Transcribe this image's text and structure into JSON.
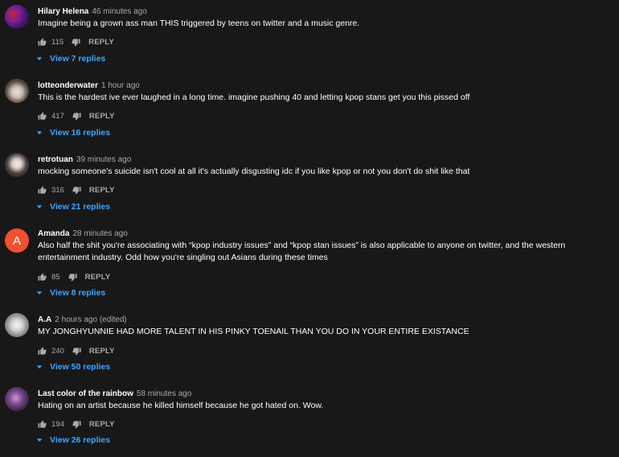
{
  "colors": {
    "background": "#181818",
    "link": "#3ea6ff",
    "muted": "#aaaaaa"
  },
  "comments": [
    {
      "author": "Hilary Helena",
      "time": "46 minutes ago",
      "text": "Imagine being a grown ass man THIS triggered by teens on twitter and a music genre.",
      "likes": "115",
      "reply": "REPLY",
      "view": "View 7 replies",
      "avatar": "avatar-photo"
    },
    {
      "author": "lotteonderwater",
      "time": "1 hour ago",
      "text": "This is the hardest ive ever laughed in a long time. imagine pushing 40 and letting kpop stans get you this pissed off",
      "likes": "417",
      "reply": "REPLY",
      "view": "View 16 replies",
      "avatar": "avatar-photo"
    },
    {
      "author": "retrotuan",
      "time": "39 minutes ago",
      "text": "mocking someone's suicide isn't cool at all it's actually disgusting idc if you like kpop or not you don't do shit like that",
      "likes": "316",
      "reply": "REPLY",
      "view": "View 21 replies",
      "avatar": "avatar-photo"
    },
    {
      "author": "Amanda",
      "time": "28 minutes ago",
      "text": "Also half the shit you're associating with “kpop industry issues” and “kpop stan issues” is also applicable to anyone on twitter, and the western entertainment industry. Odd how you're singling out Asians during these times",
      "likes": "85",
      "reply": "REPLY",
      "view": "View 8 replies",
      "avatar": "A",
      "avatar_color": "#ef5130"
    },
    {
      "author": "A.A",
      "time": "2 hours ago (edited)",
      "text": "MY JONGHYUNNIE HAD MORE TALENT IN HIS PINKY TOENAIL THAN YOU DO IN YOUR ENTIRE EXISTANCE",
      "likes": "240",
      "reply": "REPLY",
      "view": "View 50 replies",
      "avatar": "avatar-photo"
    },
    {
      "author": "Last color of the rainbow",
      "time": "58 minutes ago",
      "text": "Hating on an artist because he killed himself because he got hated on. Wow.",
      "likes": "194",
      "reply": "REPLY",
      "view": "View 26 replies",
      "avatar": "avatar-photo"
    }
  ]
}
